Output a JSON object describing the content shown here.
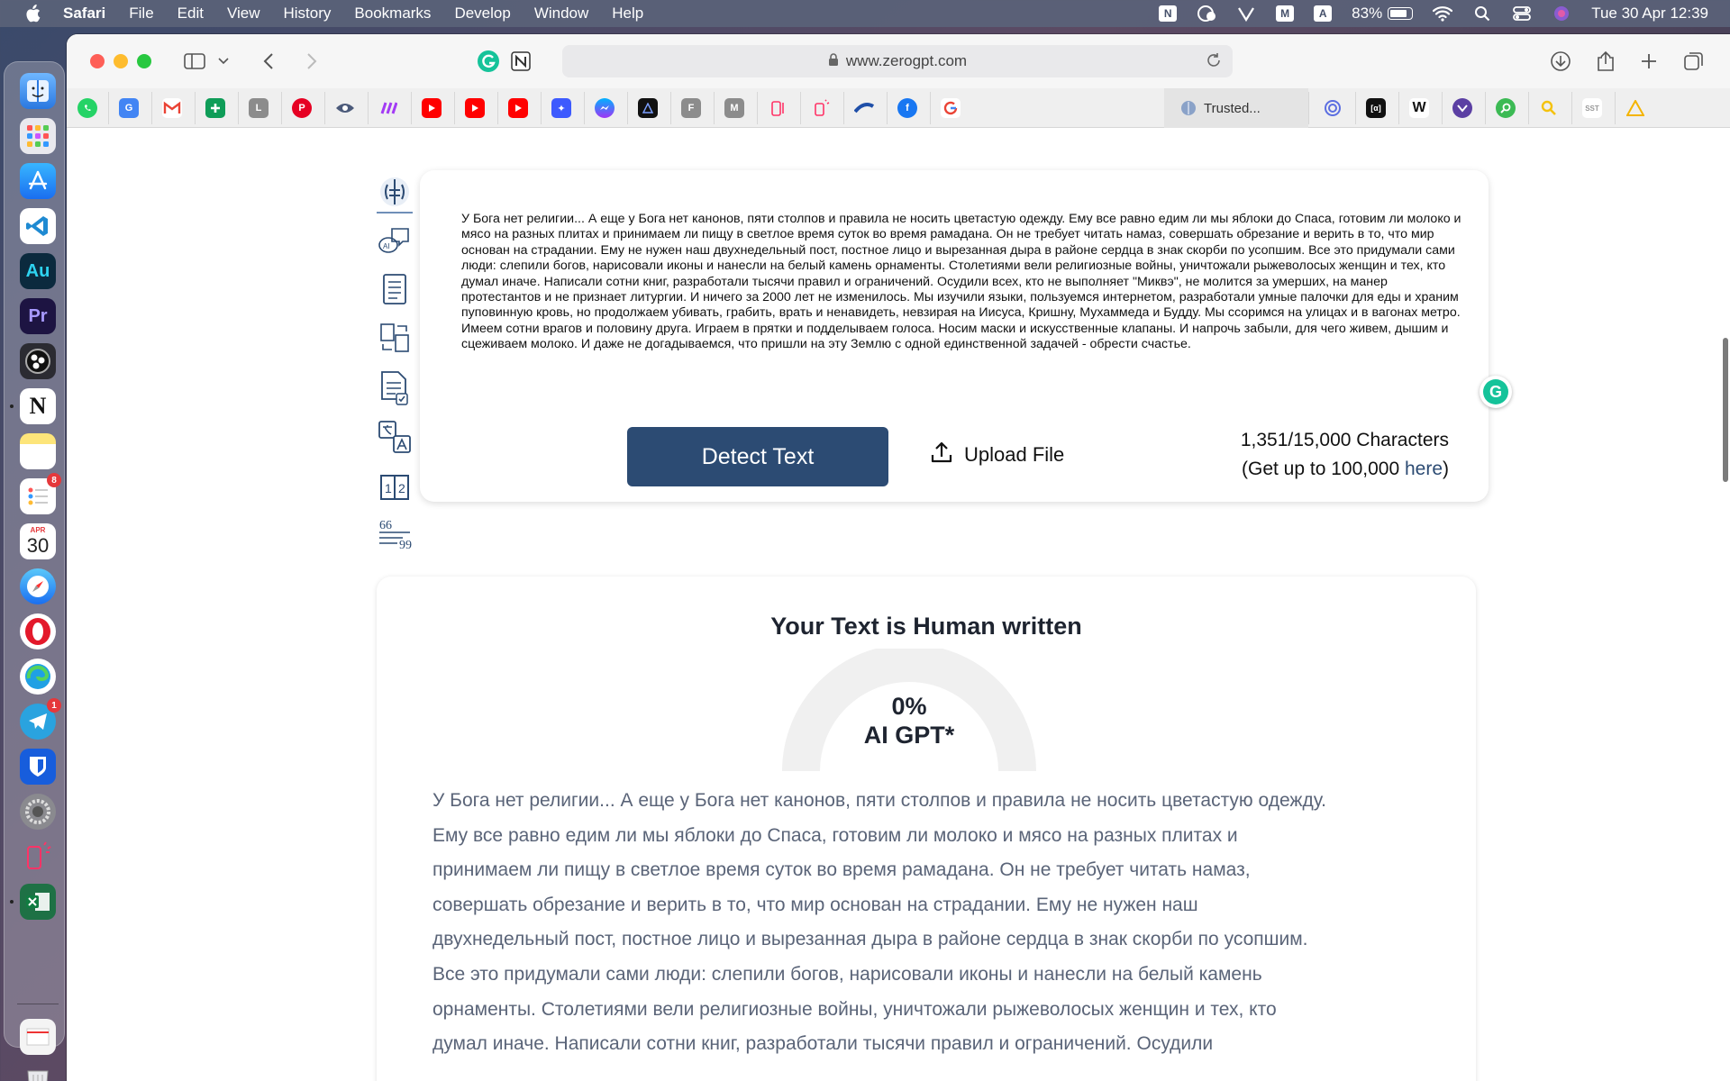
{
  "menubar": {
    "app": "Safari",
    "items": [
      "File",
      "Edit",
      "View",
      "History",
      "Bookmarks",
      "Develop",
      "Window",
      "Help"
    ],
    "battery": "83%",
    "datetime": "Tue 30 Apr  12:39"
  },
  "dock": {
    "reminders_badge": "8",
    "calendar_month": "APR",
    "calendar_day": "30",
    "telegram_badge": "1"
  },
  "browser": {
    "url": "www.zerogpt.com",
    "active_tab": "Trusted..."
  },
  "input": {
    "text": "У Бога нет религии... А еще у Бога нет канонов, пяти столпов и правила не носить цветастую одежду. Ему все равно едим ли мы яблоки до Спаса, готовим ли молоко и мясо на разных плитах и принимаем ли пищу в светлое время суток во время рамадана. Он не требует читать намаз, совершать обрезание и верить в то, что мир основан на страдании. Ему не нужен наш двухнедельный пост, постное лицо и вырезанная дыра в районе сердца в знак скорби по усопшим. Все это придумали сами люди: слепили богов, нарисовали иконы и нанесли на белый камень орнаменты. Столетиями вели религиозные войны, уничтожали рыжеволосых женщин и тех, кто думал иначе. Написали сотни книг, разработали тысячи правил и ограничений. Осудили всех, кто не выполняет \"Миквэ\", не молится за умерших, на манер протестантов и не признает литургии. И ничего за 2000 лет не изменилось. Мы изучили языки, пользуемся интернетом, разработали умные палочки для еды и храним пуповинную кровь, но продолжаем убивать, грабить, врать и ненавидеть, невзирая на Иисуса, Кришну, Мухаммеда и Будду. Мы ссоримся на улицах и в вагонах метро. Имеем сотни врагов и половину друга. Играем в прятки и подделываем голоса. Носим маски и искусственные клапаны. И напрочь забыли, для чего живем, дышим и сцеживаем молоко. И даже не догадываемся, что пришли на эту Землю с одной единственной задачей - обрести счастье.",
    "detect_label": "Detect Text",
    "upload_label": "Upload File",
    "char_count": "1,351/15,000 Characters",
    "upgrade_prefix": "(Get up to 100,000 ",
    "upgrade_link": "here",
    "upgrade_suffix": ")"
  },
  "result": {
    "title": "Your Text is Human written",
    "percent": "0%",
    "percent_value": 0,
    "label": "AI GPT*",
    "text": "У Бога нет религии... А еще у Бога нет канонов, пяти столпов и правила не носить цветастую одежду. Ему все равно едим ли мы яблоки до Спаса, готовим ли молоко и мясо на разных плитах и принимаем ли пищу в светлое время суток во время рамадана. Он не требует читать намаз, совершать обрезание и верить в то, что мир основан на страдании. Ему не нужен наш двухнедельный пост, постное лицо и вырезанная дыра в районе сердца в знак скорби по усопшим. Все это придумали сами люди: слепили богов, нарисовали иконы и нанесли на белый камень орнаменты. Столетиями вели религиозные войны, уничтожали рыжеволосых женщин и тех, кто думал иначе. Написали сотни книг, разработали тысячи правил и ограничений. Осудили"
  },
  "colors": {
    "primary": "#2c4b73",
    "gauge_track": "#f0f0f0"
  }
}
